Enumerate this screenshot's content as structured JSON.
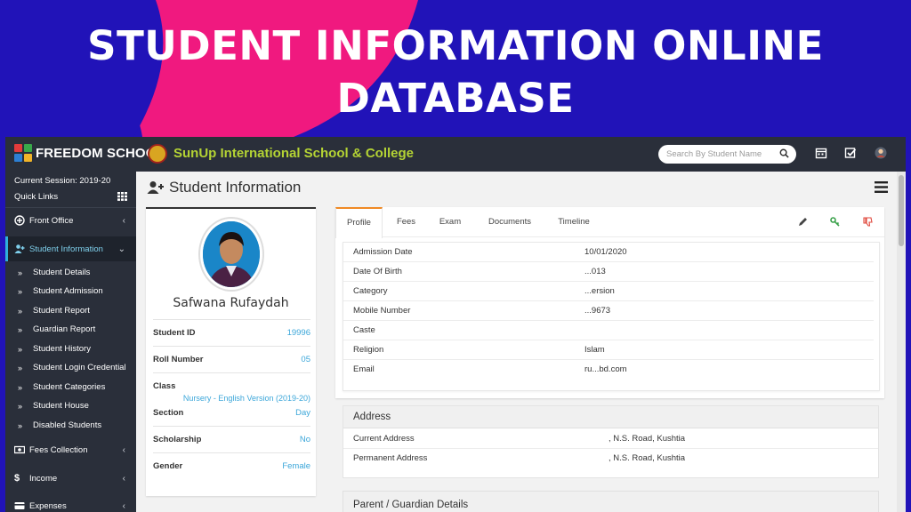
{
  "banner": {
    "title_line1": "STUDENT INFORMATION ONLINE",
    "title_line2": "DATABASE"
  },
  "topbar": {
    "logo_text": "FREEDOM SCHOOL",
    "school_name": "SunUp International School & College",
    "search_placeholder": "Search By Student Name",
    "icons": [
      "calendar-icon",
      "checkbox-icon",
      "user-avatar-icon"
    ]
  },
  "sidebar": {
    "session": "Current Session: 2019-20",
    "quick_links": "Quick Links",
    "items": [
      {
        "label": "Front Office",
        "icon": "front-office-icon"
      },
      {
        "label": "Student Information",
        "icon": "user-plus-icon",
        "active": true
      },
      {
        "label": "Fees Collection",
        "icon": "money-icon"
      },
      {
        "label": "Income",
        "icon": "dollar-icon"
      },
      {
        "label": "Expenses",
        "icon": "credit-card-icon"
      }
    ],
    "sub_items": [
      "Student Details",
      "Student Admission",
      "Student Report",
      "Guardian Report",
      "Student History",
      "Student Login Credential",
      "Student Categories",
      "Student House",
      "Disabled Students"
    ]
  },
  "main": {
    "page_title": "Student Information",
    "profile": {
      "name": "Safwana Rufaydah",
      "rows": [
        {
          "label": "Student ID",
          "value": "19996"
        },
        {
          "label": "Roll Number",
          "value": "05"
        },
        {
          "label": "Class",
          "value": "Nursery - English Version (2019-20)"
        },
        {
          "label": "Section",
          "value": "Day"
        },
        {
          "label": "Scholarship",
          "value": "No"
        },
        {
          "label": "Gender",
          "value": "Female"
        }
      ]
    },
    "tabs": [
      "Profile",
      "Fees",
      "Exam",
      "Documents",
      "Timeline"
    ],
    "details": [
      {
        "label": "Admission Date",
        "value": "10/01/2020"
      },
      {
        "label": "Date Of Birth",
        "value": "...013"
      },
      {
        "label": "Category",
        "value": "...ersion"
      },
      {
        "label": "Mobile Number",
        "value": "...9673"
      },
      {
        "label": "Caste",
        "value": ""
      },
      {
        "label": "Religion",
        "value": "Islam"
      },
      {
        "label": "Email",
        "value": "ru...bd.com"
      }
    ],
    "address": {
      "title": "Address",
      "rows": [
        {
          "label": "Current Address",
          "value": ", N.S. Road, Kushtia"
        },
        {
          "label": "Permanent Address",
          "value": ", N.S. Road, Kushtia"
        }
      ]
    },
    "parent_title": "Parent / Guardian Details"
  },
  "colors": {
    "banner_bg": "#2113b8",
    "banner_pink": "#f0197f",
    "sidebar_bg": "#2a2f3a",
    "school_name": "#b4d334",
    "accent_blue": "#3ba6d9",
    "tab_active": "#f08a24"
  }
}
